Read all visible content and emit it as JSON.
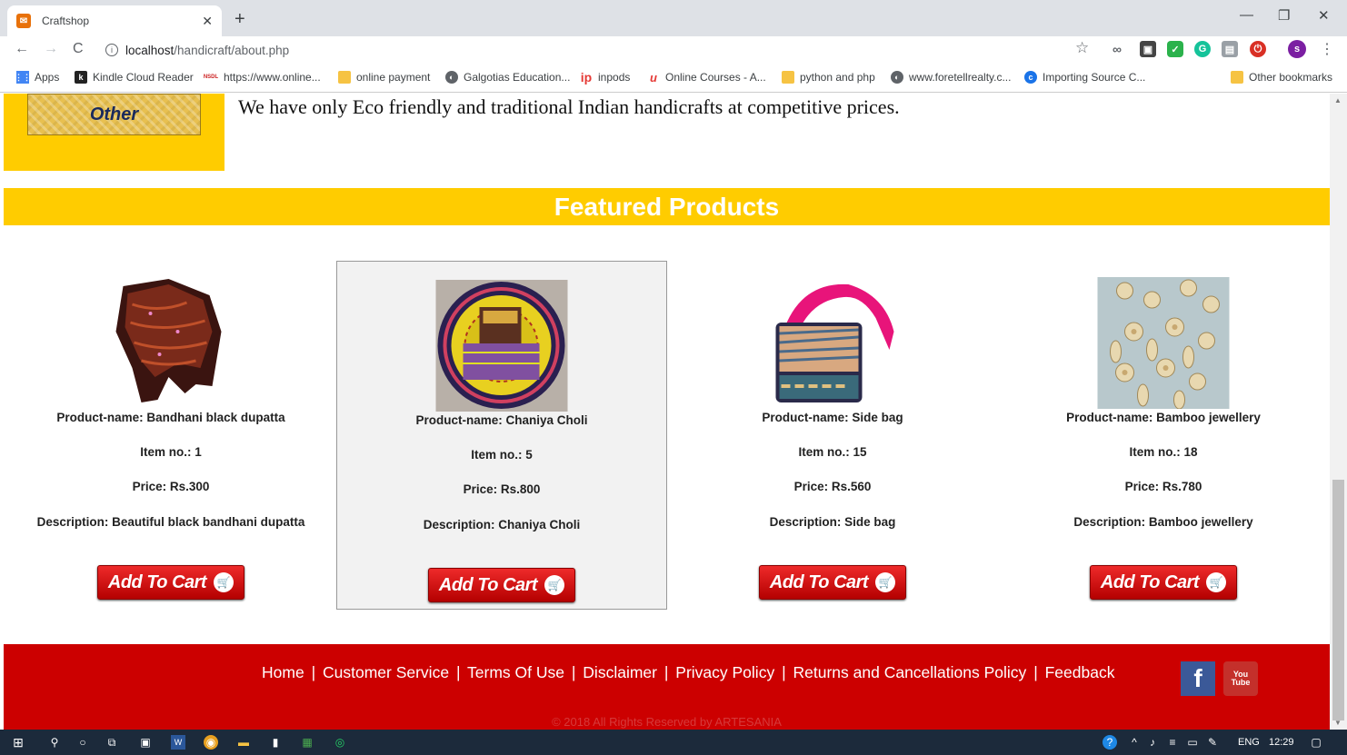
{
  "browser": {
    "tab_title": "Craftshop",
    "url_host": "localhost",
    "url_path": "/handicraft/about.php",
    "profile_initial": "s"
  },
  "bookmarks": [
    {
      "label": "Apps",
      "icon": "apps-grid-icon"
    },
    {
      "label": "Kindle Cloud Reader",
      "icon": "kindle-icon"
    },
    {
      "label": "https://www.online...",
      "icon": "nsdl-icon"
    },
    {
      "label": "online payment",
      "icon": "folder-icon"
    },
    {
      "label": "Galgotias Education...",
      "icon": "globe-icon"
    },
    {
      "label": "inpods",
      "icon": "ip-icon"
    },
    {
      "label": "Online Courses - A...",
      "icon": "udemy-icon"
    },
    {
      "label": "python and php",
      "icon": "folder-icon"
    },
    {
      "label": "www.foretellrealty.c...",
      "icon": "globe-icon"
    },
    {
      "label": "Importing Source C...",
      "icon": "doc-icon"
    },
    {
      "label": "Other bookmarks",
      "icon": "folder-icon"
    }
  ],
  "page": {
    "category_button": "Other",
    "about_text": "We have only Eco friendly and traditional Indian handicrafts at competitive prices.",
    "featured_heading": "Featured Products",
    "add_to_cart_label": "Add To Cart",
    "products": [
      {
        "name": "Product-name: Bandhani black dupatta",
        "item": "Item no.: 1",
        "price": "Price: Rs.300",
        "description": "Description: Beautiful black bandhani dupatta"
      },
      {
        "name": "Product-name: Chaniya Choli",
        "item": "Item no.: 5",
        "price": "Price: Rs.800",
        "description": "Description: Chaniya Choli"
      },
      {
        "name": "Product-name: Side bag",
        "item": "Item no.: 15",
        "price": "Price: Rs.560",
        "description": "Description: Side bag"
      },
      {
        "name": "Product-name: Bamboo jewellery",
        "item": "Item no.: 18",
        "price": "Price: Rs.780",
        "description": "Description: Bamboo jewellery"
      }
    ]
  },
  "footer": {
    "links": [
      "Home",
      "Customer Service",
      "Terms Of Use",
      "Disclaimer",
      "Privacy Policy",
      "Returns and Cancellations Policy",
      "Feedback"
    ],
    "separator": "|",
    "copyright": "© 2018 All Rights Reserved by ARTESANIA",
    "social": [
      {
        "name": "facebook-icon",
        "label": "f"
      },
      {
        "name": "youtube-icon",
        "label": "You Tube"
      }
    ]
  },
  "taskbar": {
    "language": "ENG",
    "time": "12:29"
  },
  "colors": {
    "accent_yellow": "#ffcc00",
    "footer_red": "#cc0000",
    "cart_red": "#d40000"
  }
}
